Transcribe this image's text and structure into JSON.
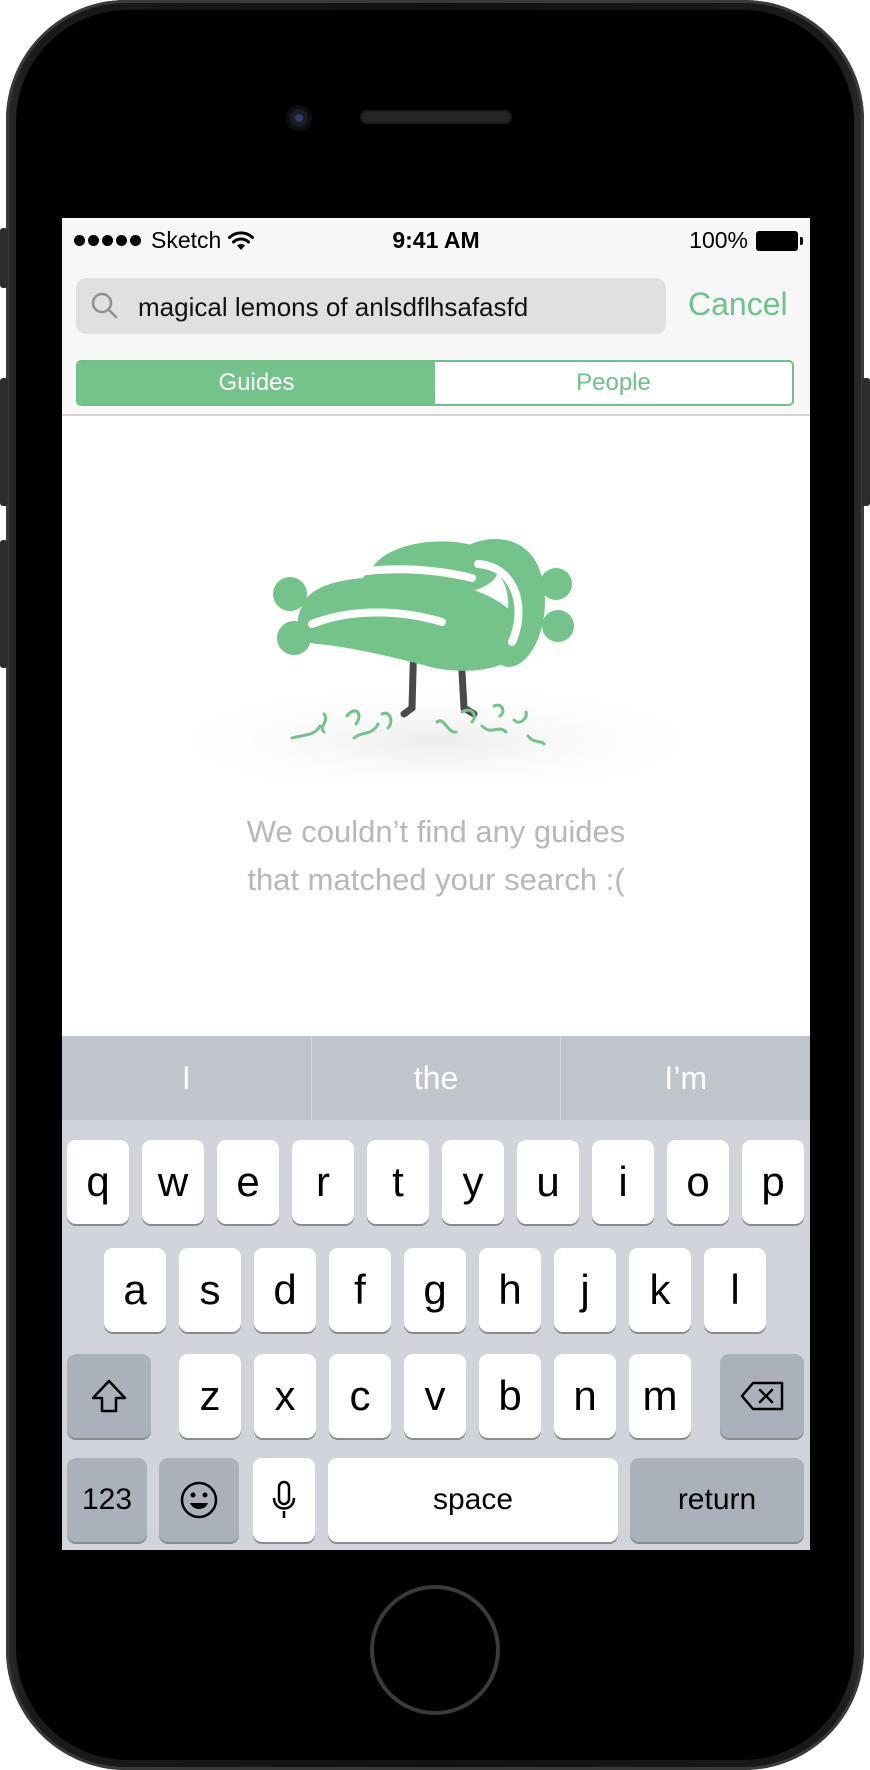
{
  "status_bar": {
    "carrier": "Sketch",
    "time": "9:41 AM",
    "battery": "100%"
  },
  "search": {
    "query": "magical lemons of anlsdflhsafasfd",
    "cancel_label": "Cancel"
  },
  "tabs": [
    {
      "label": "Guides",
      "selected": true
    },
    {
      "label": "People",
      "selected": false
    }
  ],
  "empty_state": {
    "line1": "We couldn’t find any guides",
    "line2": "that matched your search :("
  },
  "keyboard": {
    "suggestions": [
      "I",
      "the",
      "I’m"
    ],
    "row1": [
      "q",
      "w",
      "e",
      "r",
      "t",
      "y",
      "u",
      "i",
      "o",
      "p"
    ],
    "row2": [
      "a",
      "s",
      "d",
      "f",
      "g",
      "h",
      "j",
      "k",
      "l"
    ],
    "row3": [
      "z",
      "x",
      "c",
      "v",
      "b",
      "n",
      "m"
    ],
    "numbers_label": "123",
    "space_label": "space",
    "return_label": "return"
  },
  "colors": {
    "accent": "#6dc28a",
    "muted_text": "#b8b8b8",
    "keyboard_bg": "#d1d5db"
  }
}
